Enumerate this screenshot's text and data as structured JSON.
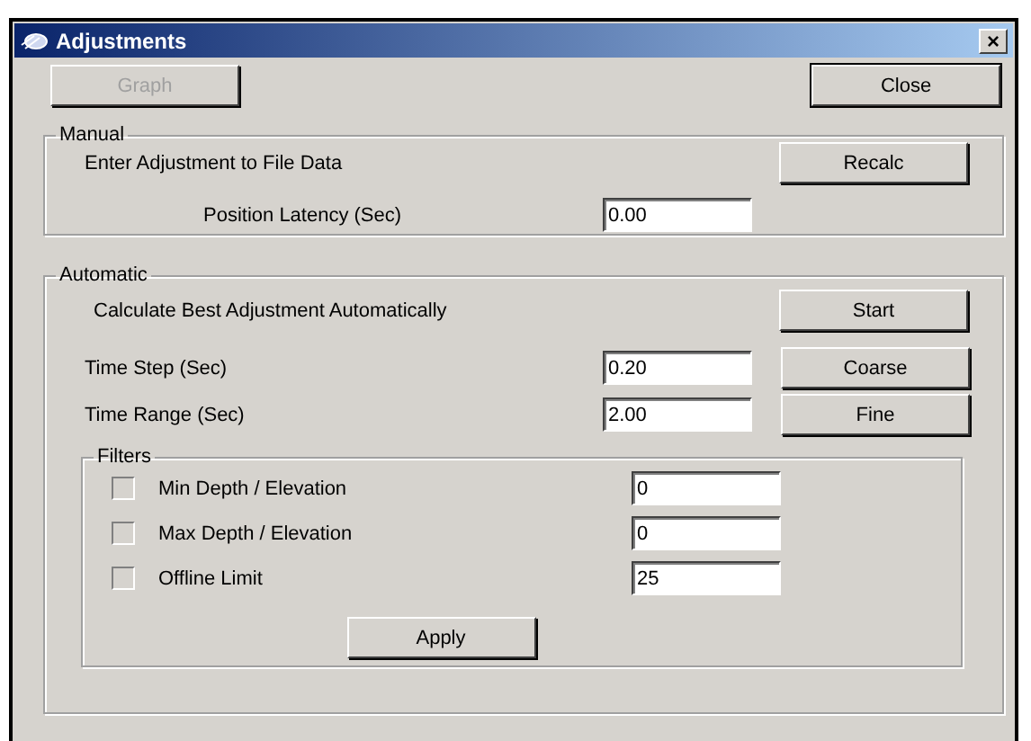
{
  "window": {
    "title": "Adjustments",
    "close_glyph": "×"
  },
  "toolbar": [
    {
      "label": "Graph",
      "disabled": true,
      "default": false
    },
    {
      "label": "Close",
      "disabled": false,
      "default": true
    }
  ],
  "manual": {
    "title": "Manual",
    "description": "Enter Adjustment to File Data",
    "button": "Recalc",
    "field_label": "Position Latency (Sec)",
    "field_value": "0.00"
  },
  "automatic": {
    "title": "Automatic",
    "description": "Calculate Best Adjustment Automatically",
    "button": "Start",
    "fields": [
      {
        "label": "Time Step (Sec)",
        "value": "0.20",
        "button": "Coarse"
      },
      {
        "label": "Time Range (Sec)",
        "value": "2.00",
        "button": "Fine"
      }
    ],
    "filters": {
      "title": "Filters",
      "items": [
        {
          "label": "Min Depth / Elevation",
          "checked": false,
          "value": "0"
        },
        {
          "label": "Max Depth / Elevation",
          "checked": false,
          "value": "0"
        },
        {
          "label": "Offline Limit",
          "checked": false,
          "value": "25"
        }
      ],
      "button": "Apply"
    }
  }
}
